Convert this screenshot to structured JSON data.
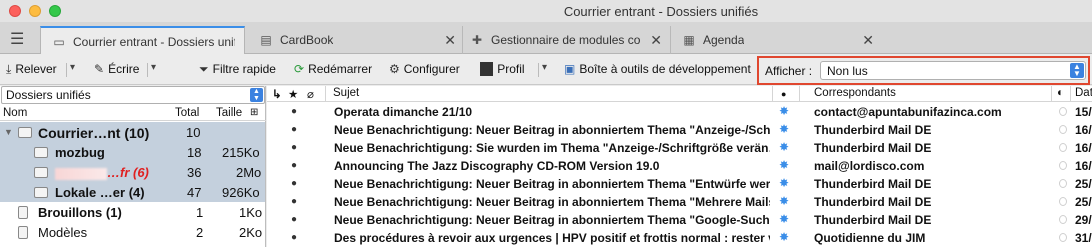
{
  "window": {
    "title": "Courrier entrant - Dossiers unifiés"
  },
  "tabs": [
    {
      "label": "Courrier entrant - Dossiers unifiés",
      "icon": "inbox-icon",
      "active": true
    },
    {
      "label": "CardBook",
      "icon": "contact-card-icon"
    },
    {
      "label": "Gestionnaire de modules complémentaires",
      "icon": "puzzle-icon"
    },
    {
      "label": "Agenda",
      "icon": "calendar-icon"
    }
  ],
  "toolbar": {
    "relever": "Relever",
    "ecrire": "Écrire",
    "filtre": "Filtre rapide",
    "redemarrer": "Redémarrer",
    "configurer": "Configurer",
    "profil": "Profil",
    "boite": "Boîte à outils de développement",
    "afficher_label": "Afficher :",
    "afficher_value": "Non lus"
  },
  "folders": {
    "selector": "Dossiers unifiés",
    "headers": {
      "nom": "Nom",
      "total": "Total",
      "taille": "Taille"
    },
    "items": [
      {
        "name": "Courrier…nt (10)",
        "total": "10",
        "size": ""
      },
      {
        "name": "mozbug",
        "total": "18",
        "size": "215Ko"
      },
      {
        "name": "…fr (6)",
        "total": "36",
        "size": "2Mo"
      },
      {
        "name": "Lokale …er (4)",
        "total": "47",
        "size": "926Ko"
      },
      {
        "name": "Brouillons (1)",
        "total": "1",
        "size": "1Ko"
      },
      {
        "name": "Modèles",
        "total": "2",
        "size": "2Ko"
      }
    ]
  },
  "messages": {
    "headers": {
      "sujet": "Sujet",
      "correspondants": "Correspondants",
      "date": "Dat"
    },
    "rows": [
      {
        "subject": "Operata dimanche 21/10",
        "from": "contact@apuntabunifazinca.com",
        "date": "15/"
      },
      {
        "subject": "Neue Benachrichtigung: Neuer Beitrag in abonniertem Thema \"Anzeige-/Schr…",
        "from": "Thunderbird Mail DE",
        "date": "16/"
      },
      {
        "subject": "Neue Benachrichtigung: Sie wurden im Thema \"Anzeige-/Schriftgröße verän…",
        "from": "Thunderbird Mail DE",
        "date": "16/"
      },
      {
        "subject": "Announcing The Jazz Discography CD-ROM Version 19.0",
        "from": "mail@lordisco.com",
        "date": "16/"
      },
      {
        "subject": "Neue Benachrichtigung: Neuer Beitrag in abonniertem Thema \"Entwürfe wer…",
        "from": "Thunderbird Mail DE",
        "date": "25/"
      },
      {
        "subject": "Neue Benachrichtigung: Neuer Beitrag in abonniertem Thema \"Mehrere Mails…",
        "from": "Thunderbird Mail DE",
        "date": "25/"
      },
      {
        "subject": "Neue Benachrichtigung: Neuer Beitrag in abonniertem Thema \"Google-Such…",
        "from": "Thunderbird Mail DE",
        "date": "29/"
      },
      {
        "subject": "Des procédures à revoir aux urgences | HPV positif et frottis normal : rester v…",
        "from": "Quotidienne du JIM",
        "date": "31/"
      }
    ]
  }
}
